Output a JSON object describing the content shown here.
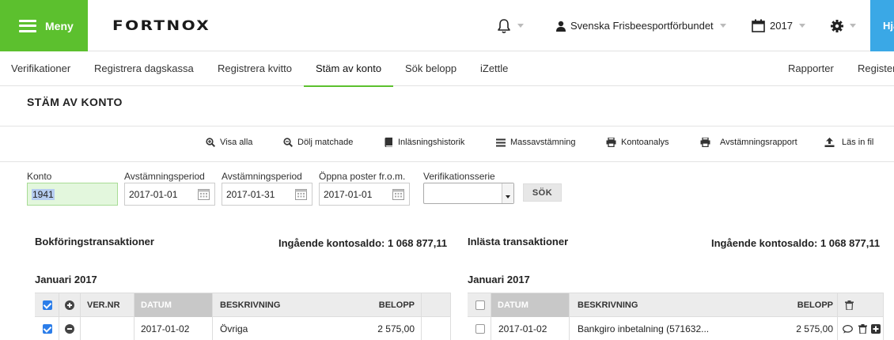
{
  "header": {
    "menu_label": "Meny",
    "logo_text": "FORTNOX",
    "company": "Svenska Frisbeesportförbundet",
    "year": "2017",
    "help_label": "Hjälp"
  },
  "nav": {
    "tabs": [
      {
        "label": "Verifikationer"
      },
      {
        "label": "Registrera dagskassa"
      },
      {
        "label": "Registrera kvitto"
      },
      {
        "label": "Stäm av konto"
      },
      {
        "label": "Sök belopp"
      },
      {
        "label": "iZettle"
      }
    ],
    "active_tab": "Stäm av konto",
    "right_tabs": [
      {
        "label": "Rapporter"
      },
      {
        "label": "Register"
      }
    ]
  },
  "page": {
    "title": "STÄM AV KONTO"
  },
  "toolbar": {
    "items": [
      {
        "label": "Visa alla",
        "icon": "zoom-in-icon"
      },
      {
        "label": "Dölj matchade",
        "icon": "zoom-out-icon"
      },
      {
        "label": "Inläsningshistorik",
        "icon": "book-icon"
      },
      {
        "label": "Massavstämning",
        "icon": "list-icon"
      },
      {
        "label": "Kontoanalys",
        "icon": "print-icon"
      },
      {
        "label": "Avstämningsrapport",
        "icon": "print-icon"
      },
      {
        "label": "Läs in fil",
        "icon": "upload-icon"
      }
    ]
  },
  "filters": {
    "konto_label": "Konto",
    "konto_value": "1941",
    "period_from_label": "Avstämningsperiod",
    "period_from_value": "2017-01-01",
    "period_to_label": "Avstämningsperiod",
    "period_to_value": "2017-01-31",
    "open_from_label": "Öppna poster fr.o.m.",
    "open_from_value": "2017-01-01",
    "series_label": "Verifikationsserie",
    "series_value": "",
    "search_label": "SÖK"
  },
  "left_panel": {
    "title": "Bokföringstransaktioner",
    "saldo": "Ingående kontosaldo: 1 068 877,11",
    "month": "Januari 2017",
    "columns": {
      "vernr": "VER.NR",
      "datum": "DATUM",
      "beskrivning": "BESKRIVNING",
      "belopp": "BELOPP"
    },
    "rows": [
      {
        "checked": true,
        "vernr": "",
        "datum": "2017-01-02",
        "beskrivning": "Övriga",
        "belopp": "2 575,00"
      }
    ]
  },
  "right_panel": {
    "title": "Inlästa transaktioner",
    "saldo": "Ingående kontosaldo: 1 068 877,11",
    "month": "Januari 2017",
    "columns": {
      "datum": "DATUM",
      "beskrivning": "BESKRIVNING",
      "belopp": "BELOPP"
    },
    "rows": [
      {
        "checked": false,
        "datum": "2017-01-02",
        "beskrivning": "Bankgiro inbetalning (571632...",
        "belopp": "2 575,00"
      }
    ]
  },
  "colors": {
    "brand_green": "#5cc02e",
    "help_blue": "#3aa8e6",
    "checkbox_blue": "#2b7de9",
    "konto_field_bg": "#e3f7dd"
  }
}
